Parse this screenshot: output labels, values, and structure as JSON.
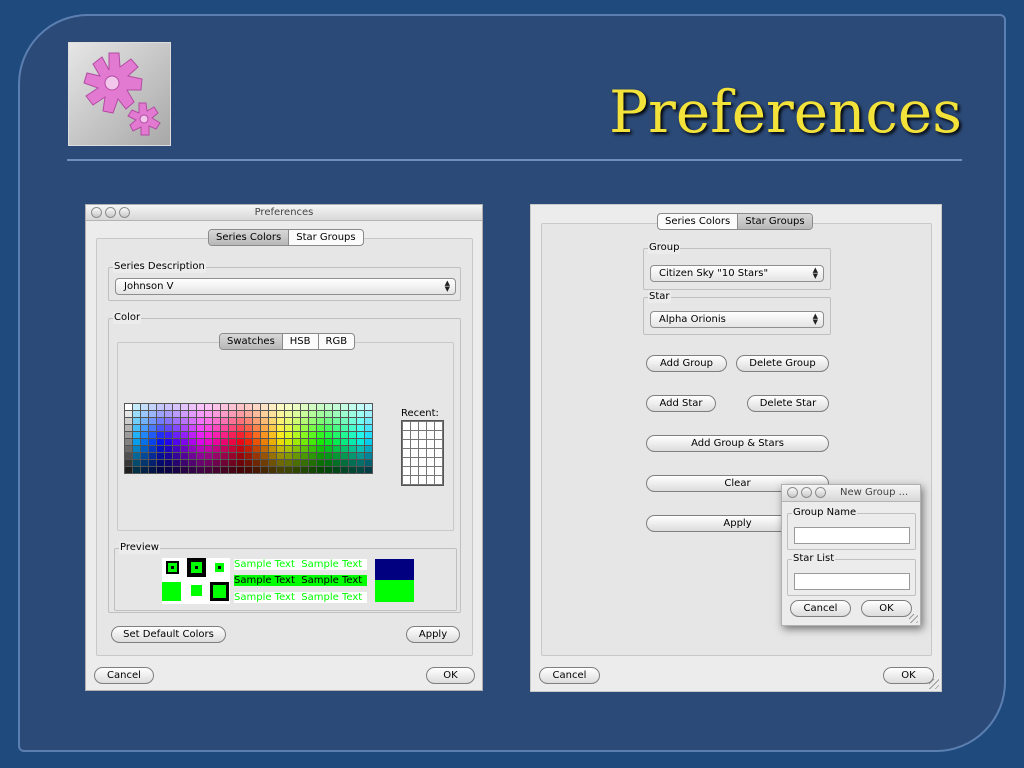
{
  "slide": {
    "title": "Preferences"
  },
  "left_window": {
    "title": "Preferences",
    "tabs": [
      "Series Colors",
      "Star Groups"
    ],
    "selected_tab": "Series Colors",
    "series_description": {
      "label": "Series Description",
      "value": "Johnson V"
    },
    "color": {
      "label": "Color",
      "tabs": [
        "Swatches",
        "HSB",
        "RGB"
      ],
      "selected_tab": "Swatches",
      "recent_label": "Recent:"
    },
    "preview": {
      "label": "Preview",
      "sample_text": "Sample Text",
      "foreground_color": "#00ff00",
      "background_color": "#000080"
    },
    "buttons": {
      "set_default_colors": "Set Default Colors",
      "apply": "Apply",
      "cancel": "Cancel",
      "ok": "OK"
    }
  },
  "right_window": {
    "tabs": [
      "Series Colors",
      "Star Groups"
    ],
    "selected_tab": "Star Groups",
    "group": {
      "label": "Group",
      "value": "Citizen Sky \"10 Stars\""
    },
    "star": {
      "label": "Star",
      "value": "Alpha Orionis"
    },
    "buttons": {
      "add_group": "Add Group",
      "delete_group": "Delete Group",
      "add_star": "Add Star",
      "delete_star": "Delete Star",
      "add_group_stars": "Add Group & Stars",
      "clear": "Clear",
      "apply": "Apply",
      "cancel": "Cancel",
      "ok": "OK"
    }
  },
  "new_group_dialog": {
    "title": "New Group ...",
    "group_name_label": "Group Name",
    "group_name_value": "",
    "star_list_label": "Star List",
    "star_list_value": "",
    "buttons": {
      "cancel": "Cancel",
      "ok": "OK"
    }
  }
}
